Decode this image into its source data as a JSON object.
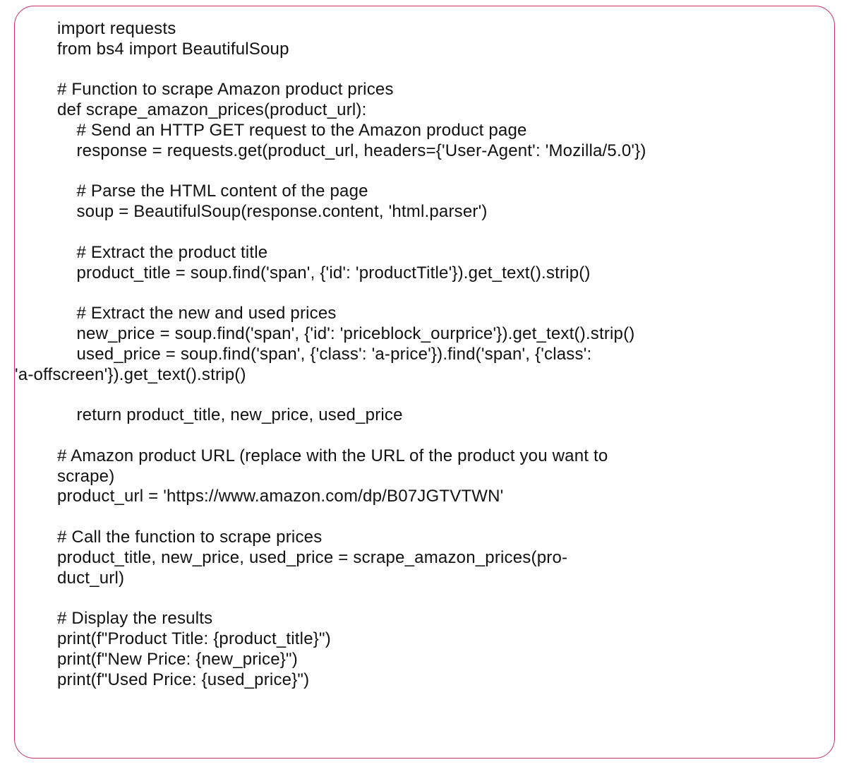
{
  "code": {
    "l01": "import requests",
    "l02": "from bs4 import BeautifulSoup",
    "l03": "",
    "l04": "# Function to scrape Amazon product prices",
    "l05": "def scrape_amazon_prices(product_url):",
    "l06": "    # Send an HTTP GET request to the Amazon product page",
    "l07": "    response = requests.get(product_url, headers={'User-Agent': 'Mozilla/5.0'})",
    "l08": "",
    "l09": "    # Parse the HTML content of the page",
    "l10": "    soup = BeautifulSoup(response.content, 'html.parser')",
    "l11": "",
    "l12": "    # Extract the product title",
    "l13": "    product_title = soup.find('span', {'id': 'productTitle'}).get_text().strip()",
    "l14": "",
    "l15": "    # Extract the new and used prices",
    "l16": "    new_price = soup.find('span', {'id': 'priceblock_ourprice'}).get_text().strip()",
    "l17a": "    used_price = soup.find('span', {'class': 'a-price'}).find('span', {'class':",
    "l17b": "'a-offscreen'}).get_text().strip()",
    "l18": "",
    "l19": "    return product_title, new_price, used_price",
    "l20": "",
    "l21a": "# Amazon product URL (replace with the URL of the product you want to",
    "l21b": "scrape)",
    "l22": "product_url = 'https://www.amazon.com/dp/B07JGTVTWN'",
    "l23": "",
    "l24": "# Call the function to scrape prices",
    "l25a": "product_title, new_price, used_price = scrape_amazon_prices(pro-",
    "l25b": "duct_url)",
    "l26": "",
    "l27": "# Display the results",
    "l28": "print(f\"Product Title: {product_title}\")",
    "l29": "print(f\"New Price: {new_price}\")",
    "l30": "print(f\"Used Price: {used_price}\")"
  }
}
